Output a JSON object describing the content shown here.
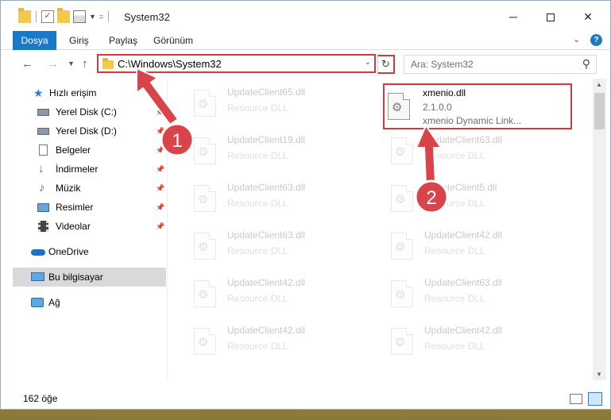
{
  "window": {
    "title": "System32",
    "controls": {
      "minimize": "─",
      "close": "✕"
    }
  },
  "ribbon": {
    "tabs": [
      "Dosya",
      "Giriş",
      "Paylaş",
      "Görünüm"
    ],
    "help": "?"
  },
  "address": {
    "path": "C:\\Windows\\System32",
    "search_placeholder": "Ara: System32"
  },
  "sidebar": {
    "items": [
      {
        "label": "Hızlı erişim",
        "icon": "star-icon",
        "pinned": false
      },
      {
        "label": "Yerel Disk (C:)",
        "icon": "drive-icon",
        "pinned": true
      },
      {
        "label": "Yerel Disk (D:)",
        "icon": "drive-icon",
        "pinned": true
      },
      {
        "label": "Belgeler",
        "icon": "document-icon",
        "pinned": true
      },
      {
        "label": "İndirmeler",
        "icon": "download-icon",
        "pinned": true
      },
      {
        "label": "Müzik",
        "icon": "music-icon",
        "pinned": true
      },
      {
        "label": "Resimler",
        "icon": "pictures-icon",
        "pinned": true
      },
      {
        "label": "Videolar",
        "icon": "video-icon",
        "pinned": true
      },
      {
        "label": "OneDrive",
        "icon": "cloud-icon",
        "pinned": false
      },
      {
        "label": "Bu bilgisayar",
        "icon": "computer-icon",
        "pinned": false,
        "selected": true
      },
      {
        "label": "Ağ",
        "icon": "network-icon",
        "pinned": false
      }
    ]
  },
  "files": {
    "left_column": [
      {
        "name": "UpdateClient65.dll",
        "type": "Resource DLL"
      },
      {
        "name": "UpdateClient19.dll",
        "type": "Resource DLL"
      },
      {
        "name": "UpdateClient63.dll",
        "type": "Resource DLL"
      },
      {
        "name": "UpdateClient63.dll",
        "type": "Resource DLL"
      },
      {
        "name": "UpdateClient42.dll",
        "type": "Resource DLL"
      },
      {
        "name": "UpdateClient42.dll",
        "type": "Resource DLL"
      }
    ],
    "highlighted": {
      "name": "xmenio.dll",
      "version": "2.1.0.0",
      "description": "xmenio Dynamic Link..."
    },
    "right_column": [
      {
        "name": "UpdateClient63.dll",
        "type": "Resource DLL"
      },
      {
        "name": "UpdateClient5.dll",
        "type": "Resource DLL"
      },
      {
        "name": "UpdateClient42.dll",
        "type": "Resource DLL"
      },
      {
        "name": "UpdateClient63.dll",
        "type": "Resource DLL"
      },
      {
        "name": "UpdateClient42.dll",
        "type": "Resource DLL"
      }
    ]
  },
  "status": {
    "item_count": "162 öğe"
  },
  "annotations": {
    "step1": "1",
    "step2": "2",
    "color": "#d4393f"
  }
}
